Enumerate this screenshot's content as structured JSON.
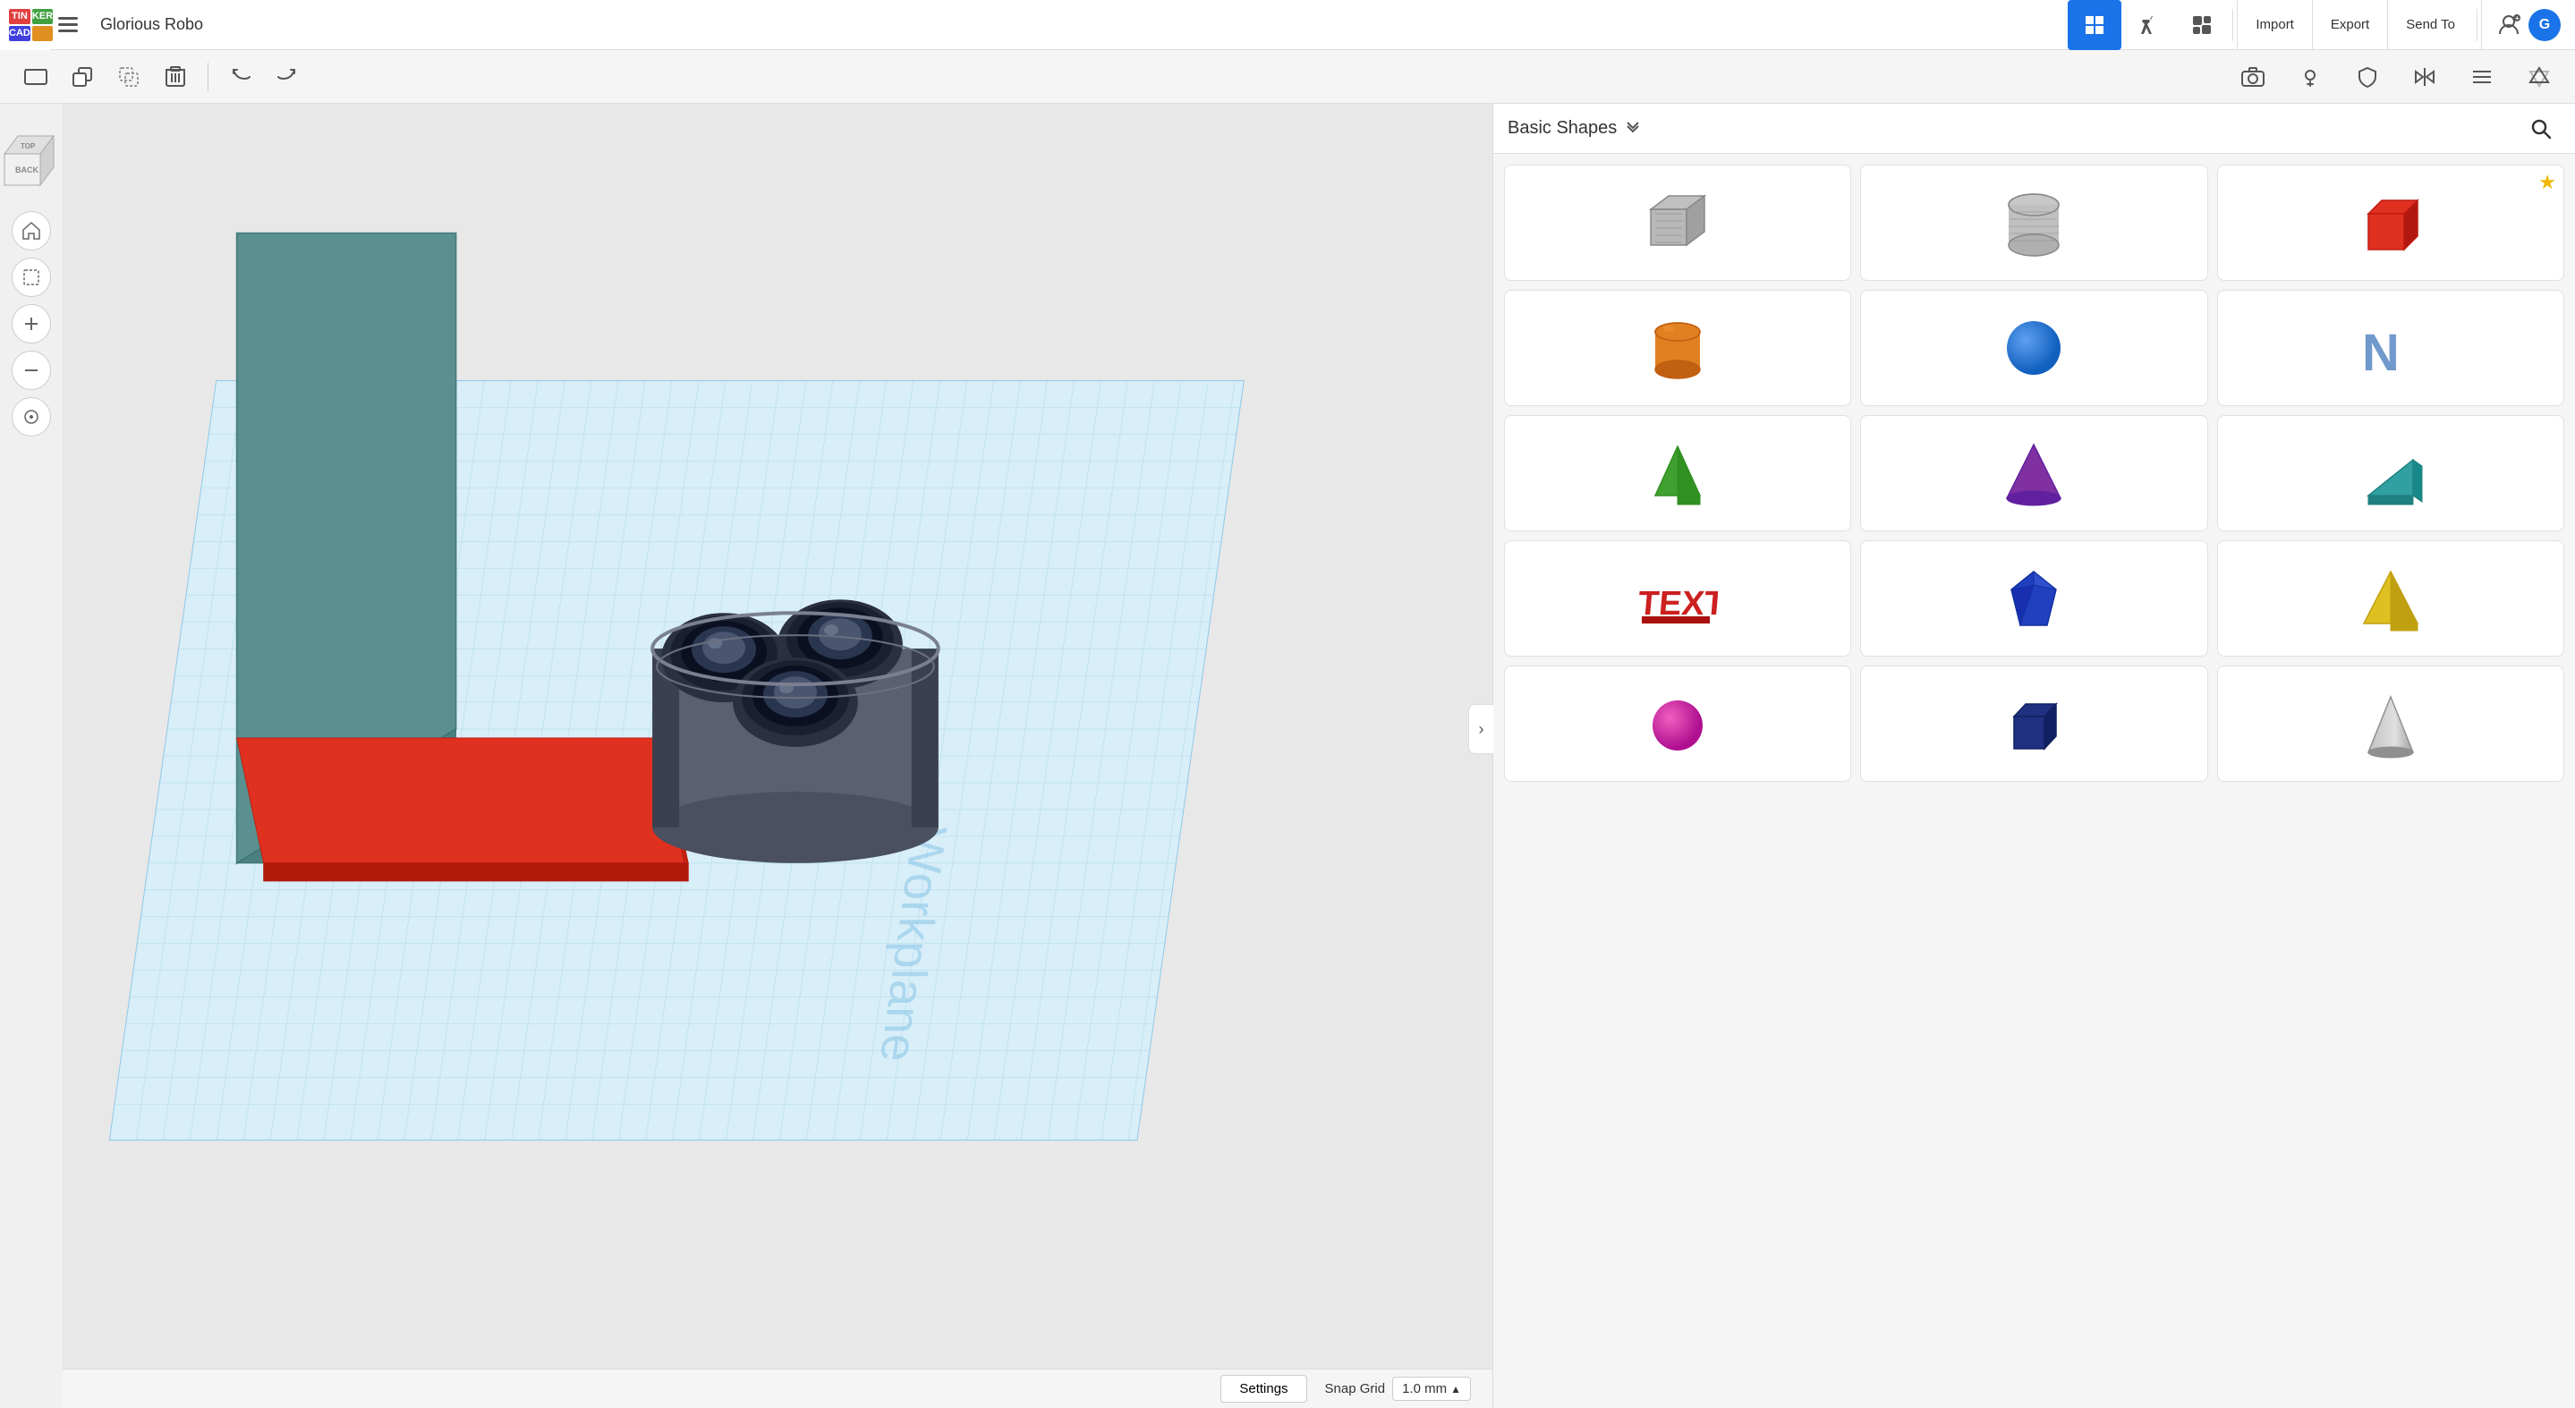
{
  "header": {
    "logo": {
      "tin": "TIN",
      "ker": "KER",
      "cad": "CAD"
    },
    "project_name": "Glorious Robo",
    "nav_buttons": [
      {
        "id": "grid",
        "icon": "⊞",
        "active": true
      },
      {
        "id": "pickaxe",
        "icon": "⛏",
        "active": false
      },
      {
        "id": "box",
        "icon": "⬛",
        "active": false
      }
    ],
    "action_buttons": [
      {
        "label": "Import"
      },
      {
        "label": "Export"
      },
      {
        "label": "Send To"
      }
    ]
  },
  "toolbar": {
    "left_tools": [
      {
        "id": "workplane",
        "icon": "▭",
        "tooltip": "Workplane"
      },
      {
        "id": "copy",
        "icon": "⧉",
        "tooltip": "Copy"
      },
      {
        "id": "paste",
        "icon": "⬚",
        "tooltip": "Paste"
      },
      {
        "id": "delete",
        "icon": "🗑",
        "tooltip": "Delete"
      },
      {
        "id": "undo",
        "icon": "↩",
        "tooltip": "Undo"
      },
      {
        "id": "redo",
        "icon": "↪",
        "tooltip": "Redo"
      }
    ],
    "right_tools": [
      {
        "id": "camera",
        "icon": "◎",
        "tooltip": "Camera"
      },
      {
        "id": "light",
        "icon": "💡",
        "tooltip": "Light"
      },
      {
        "id": "shield",
        "icon": "⬡",
        "tooltip": "Shield"
      },
      {
        "id": "mirror",
        "icon": "⊙",
        "tooltip": "Mirror"
      },
      {
        "id": "align",
        "icon": "⊟",
        "tooltip": "Align"
      },
      {
        "id": "flip",
        "icon": "△",
        "tooltip": "Flip"
      }
    ]
  },
  "view_controls": [
    {
      "id": "home",
      "icon": "⌂",
      "tooltip": "Home view"
    },
    {
      "id": "select-box",
      "icon": "⬚",
      "tooltip": "Select box"
    },
    {
      "id": "zoom-in",
      "icon": "+",
      "tooltip": "Zoom in"
    },
    {
      "id": "zoom-out",
      "icon": "−",
      "tooltip": "Zoom out"
    },
    {
      "id": "fit",
      "icon": "◎",
      "tooltip": "Fit all"
    }
  ],
  "shapes_panel": {
    "title": "Basic Shapes",
    "search_placeholder": "Search shapes",
    "shapes": [
      {
        "id": "box-hatch",
        "label": "Box Hatch",
        "color": "#aaa",
        "type": "hatch-box"
      },
      {
        "id": "cylinder-hatch",
        "label": "Cylinder Hatch",
        "color": "#bbb",
        "type": "hatch-cyl"
      },
      {
        "id": "cube-red",
        "label": "Cube",
        "color": "#e03020",
        "type": "cube",
        "starred": true
      },
      {
        "id": "cylinder-orange",
        "label": "Cylinder",
        "color": "#e08020",
        "type": "cylinder"
      },
      {
        "id": "sphere-blue",
        "label": "Sphere",
        "color": "#2080e0",
        "type": "sphere"
      },
      {
        "id": "text-3d",
        "label": "Text",
        "color": "#e03020",
        "type": "text"
      },
      {
        "id": "pyramid-green",
        "label": "Pyramid",
        "color": "#40a030",
        "type": "pyramid-green"
      },
      {
        "id": "cone-purple",
        "label": "Cone",
        "color": "#8030a0",
        "type": "cone-purple"
      },
      {
        "id": "wedge-teal",
        "label": "Wedge",
        "color": "#30a0a0",
        "type": "wedge"
      },
      {
        "id": "text-shape",
        "label": "Text",
        "color": "#cc2020",
        "type": "text-shape"
      },
      {
        "id": "gem-blue",
        "label": "Gem",
        "color": "#2040c0",
        "type": "gem"
      },
      {
        "id": "pyramid-yellow",
        "label": "Pyramid Yellow",
        "color": "#e0c020",
        "type": "pyramid-yellow"
      },
      {
        "id": "sphere-pink",
        "label": "Sphere Pink",
        "color": "#e020a0",
        "type": "sphere-pink"
      },
      {
        "id": "cube-navy",
        "label": "Cube Navy",
        "color": "#203080",
        "type": "cube-navy"
      },
      {
        "id": "cone-gray",
        "label": "Cone Gray",
        "color": "#a0a0a0",
        "type": "cone-gray"
      }
    ]
  },
  "status_bar": {
    "settings_label": "Settings",
    "snap_grid_label": "Snap Grid",
    "snap_grid_value": "1.0 mm",
    "snap_grid_arrow": "▲"
  },
  "panel_tabs": [
    {
      "id": "grid-tab",
      "icon": "⊞",
      "active": true
    },
    {
      "id": "ruler-tab",
      "icon": "📐",
      "active": false
    },
    {
      "id": "comment-tab",
      "icon": "💬",
      "active": false
    }
  ]
}
